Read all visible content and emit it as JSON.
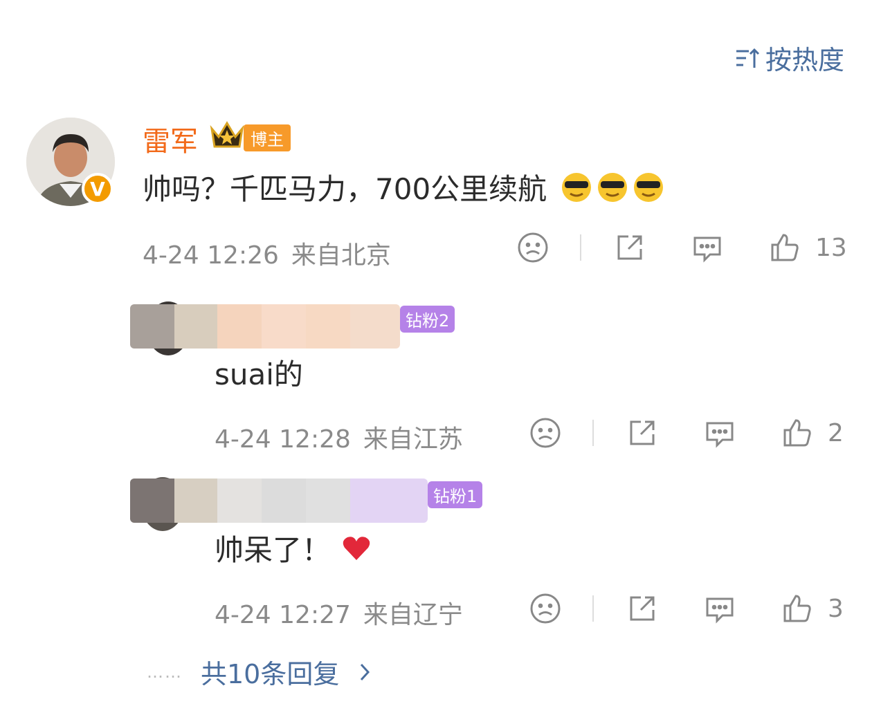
{
  "header": {
    "sort_label": "按热度"
  },
  "main_comment": {
    "author": "雷军",
    "role_badge": "博主",
    "text": "帅吗？千匹马力，700公里续航",
    "emojis": [
      "cool-face-emoji",
      "cool-face-emoji",
      "cool-face-emoji"
    ],
    "time": "4-24 12:26",
    "location": "来自北京",
    "likes": "13"
  },
  "replies": [
    {
      "fan_badge": "钻粉2",
      "text": "suai的",
      "time": "4-24 12:28",
      "location": "来自江苏",
      "likes": "2"
    },
    {
      "fan_badge": "钻粉1",
      "text": "帅呆了！",
      "emoji": "red-heart-emoji",
      "time": "4-24 12:27",
      "location": "来自辽宁",
      "likes": "3"
    }
  ],
  "more_replies": {
    "label": "共10条回复",
    "dots": "……"
  },
  "colors": {
    "accent": "#4a6e9e",
    "author": "#f26a1a",
    "fan_badge": "#b582e8",
    "blogger_badge": "#f79a2a"
  }
}
